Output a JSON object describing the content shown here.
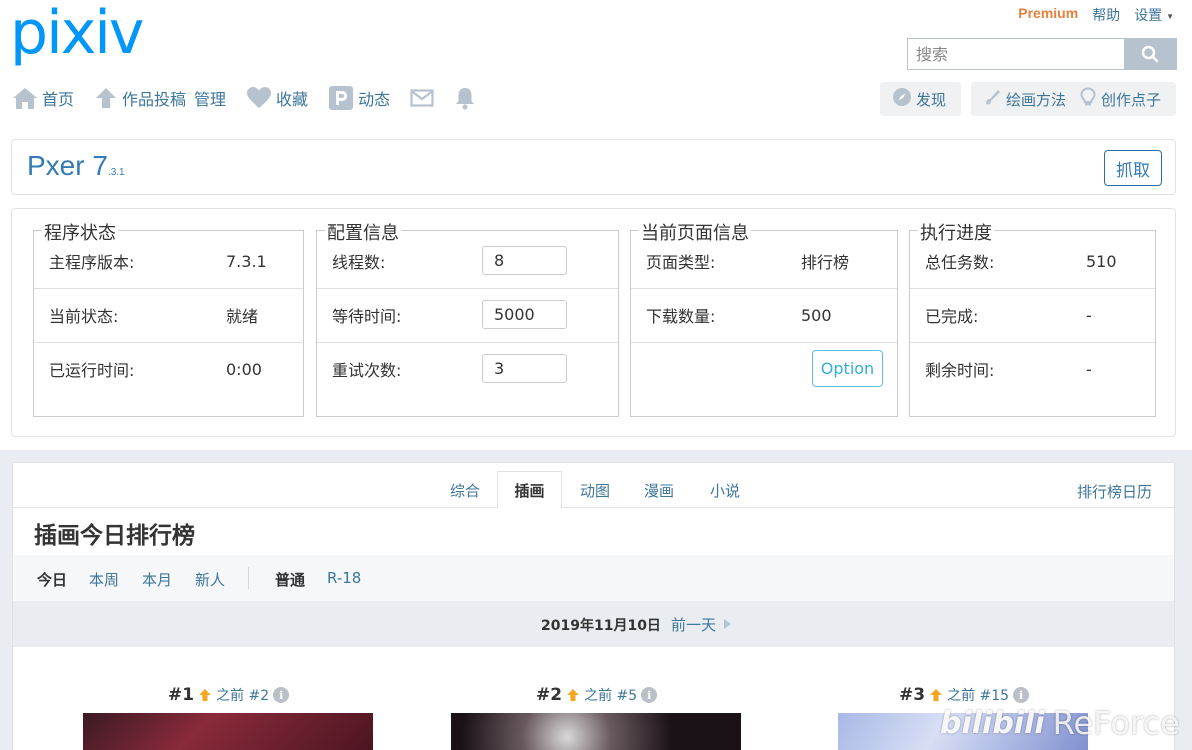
{
  "header": {
    "logo": "pixiv",
    "premium": "Premium",
    "help": "帮助",
    "settings": "设置",
    "search_placeholder": "搜索"
  },
  "nav": {
    "home": "首页",
    "post": "作品投稿",
    "manage": "管理",
    "bookmarks": "收藏",
    "feed": "动态"
  },
  "right_buttons": {
    "discover": "发现",
    "howto": "绘画方法",
    "ideas": "创作点子"
  },
  "pxer": {
    "title": "Pxer 7",
    "version": ".3.1",
    "fetch": "抓取",
    "status": {
      "legend": "程序状态",
      "rows": [
        {
          "label": "主程序版本:",
          "value": "7.3.1"
        },
        {
          "label": "当前状态:",
          "value": "就绪"
        },
        {
          "label": "已运行时间:",
          "value": "0:00"
        }
      ]
    },
    "config": {
      "legend": "配置信息",
      "rows": [
        {
          "label": "线程数:",
          "value": "8"
        },
        {
          "label": "等待时间:",
          "value": "5000"
        },
        {
          "label": "重试次数:",
          "value": "3"
        }
      ]
    },
    "page_info": {
      "legend": "当前页面信息",
      "rows": [
        {
          "label": "页面类型:",
          "value": "排行榜"
        },
        {
          "label": "下载数量:",
          "value": "500"
        }
      ],
      "option": "Option"
    },
    "progress": {
      "legend": "执行进度",
      "rows": [
        {
          "label": "总任务数:",
          "value": "510"
        },
        {
          "label": "已完成:",
          "value": "-"
        },
        {
          "label": "剩余时间:",
          "value": "-"
        }
      ]
    }
  },
  "ranking": {
    "tabs": [
      "综合",
      "插画",
      "动图",
      "漫画",
      "小说"
    ],
    "active_tab": "插画",
    "calendar": "排行榜日历",
    "title": "插画今日排行榜",
    "periods": [
      "今日",
      "本周",
      "本月",
      "新人"
    ],
    "modes": [
      "普通",
      "R-18"
    ],
    "date": "2019年11月10日",
    "prev_day": "前一天",
    "entries": [
      {
        "rank": "#1",
        "prev": "之前 #2"
      },
      {
        "rank": "#2",
        "prev": "之前 #5"
      },
      {
        "rank": "#3",
        "prev": "之前 #15"
      }
    ]
  },
  "watermark": {
    "bili": "bilibili",
    "reforce": "ReForce"
  },
  "colors": {
    "link": "#3d7699",
    "pixiv_blue": "#0096fa",
    "premium": "#e6803a",
    "rank_up": "#f5a623"
  }
}
